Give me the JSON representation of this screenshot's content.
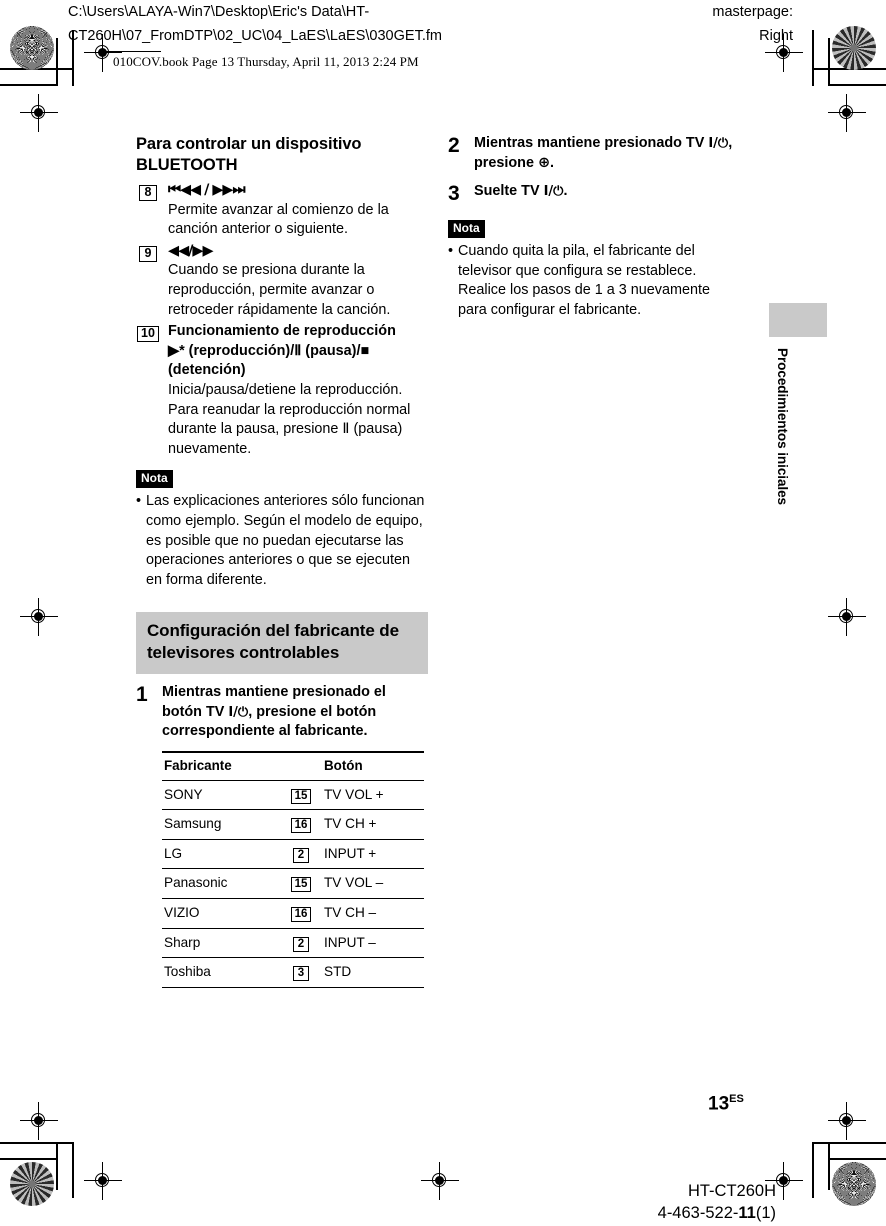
{
  "slug": {
    "file_path": "C:\\Users\\ALAYA-Win7\\Desktop\\Eric's Data\\HT-\nCT260H\\07_FromDTP\\02_UC\\04_LaES\\LaES\\030GET.fm",
    "masterpage_label": "masterpage:\nRight",
    "book_line": "010COV.book  Page 13  Thursday, April 11, 2013  2:24 PM"
  },
  "left_column": {
    "section_title": "Para controlar un dispositivo BLUETOOTH",
    "key_items": [
      {
        "number": "8",
        "label": "⏮◀◀ / ▶▶⏭",
        "label_plain": "|◀◀/▶▶|",
        "body": "Permite avanzar al comienzo de la canción anterior o siguiente."
      },
      {
        "number": "9",
        "label": "◀◀/▶▶",
        "body": "Cuando se presiona durante la reproducción, permite avanzar o retroceder rápidamente la canción."
      },
      {
        "number": "10",
        "label_line1": "Funcionamiento de reproducción",
        "label_line2": "▶* (reproducción)/Ⅱ (pausa)/■ (detención)",
        "body": "Inicia/pausa/detiene la reproducción.",
        "body2_pre": "Para reanudar la reproducción normal durante la pausa, presione ",
        "body2_post": " (pausa) nuevamente."
      }
    ],
    "nota_badge": "Nota",
    "nota_items": [
      "Las explicaciones anteriores sólo funcionan como ejemplo. Según el modelo de equipo, es posible que no puedan ejecutarse las operaciones anteriores o que se ejecuten en forma diferente."
    ],
    "banner_title": "Configuración del fabricante de televisores controlables",
    "step1": {
      "number": "1",
      "text_pre": "Mientras mantiene presionado el botón TV ",
      "text_power": "I/⏻",
      "text_post": ", presione el botón correspondiente al fabricante."
    },
    "table": {
      "headers": [
        "Fabricante",
        "Botón"
      ],
      "rows": [
        {
          "fabricante": "SONY",
          "btn_num": "15",
          "btn_label": "TV VOL +"
        },
        {
          "fabricante": "Samsung",
          "btn_num": "16",
          "btn_label": "TV CH +"
        },
        {
          "fabricante": "LG",
          "btn_num": "2",
          "btn_label": "INPUT +"
        },
        {
          "fabricante": "Panasonic",
          "btn_num": "15",
          "btn_label": "TV VOL –"
        },
        {
          "fabricante": "VIZIO",
          "btn_num": "16",
          "btn_label": "TV CH –"
        },
        {
          "fabricante": "Sharp",
          "btn_num": "2",
          "btn_label": "INPUT –"
        },
        {
          "fabricante": "Toshiba",
          "btn_num": "3",
          "btn_label": "STD"
        }
      ]
    }
  },
  "right_column": {
    "step2": {
      "number": "2",
      "text_pre": "Mientras mantiene presionado TV ",
      "text_power": "I/⏻",
      "text_mid": ", presione ",
      "text_symbol": "⊕",
      "text_post": "."
    },
    "step3": {
      "number": "3",
      "text_pre": "Suelte TV ",
      "text_power": "I/⏻",
      "text_post": "."
    },
    "nota_badge": "Nota",
    "nota_items": [
      "Cuando quita la pila, el fabricante del televisor que configura se restablece. Realice los pasos de 1 a 3 nuevamente para configurar el fabricante."
    ]
  },
  "side_tab": {
    "label": "Procedimientos iniciales",
    "box_color": "#c9c9c9"
  },
  "footer": {
    "page_number": "13",
    "page_suffix": "ES",
    "model": "HT-CT260H",
    "part_number_pre": "4-463-522-",
    "part_number_bold": "11",
    "part_number_post": "(1)"
  }
}
